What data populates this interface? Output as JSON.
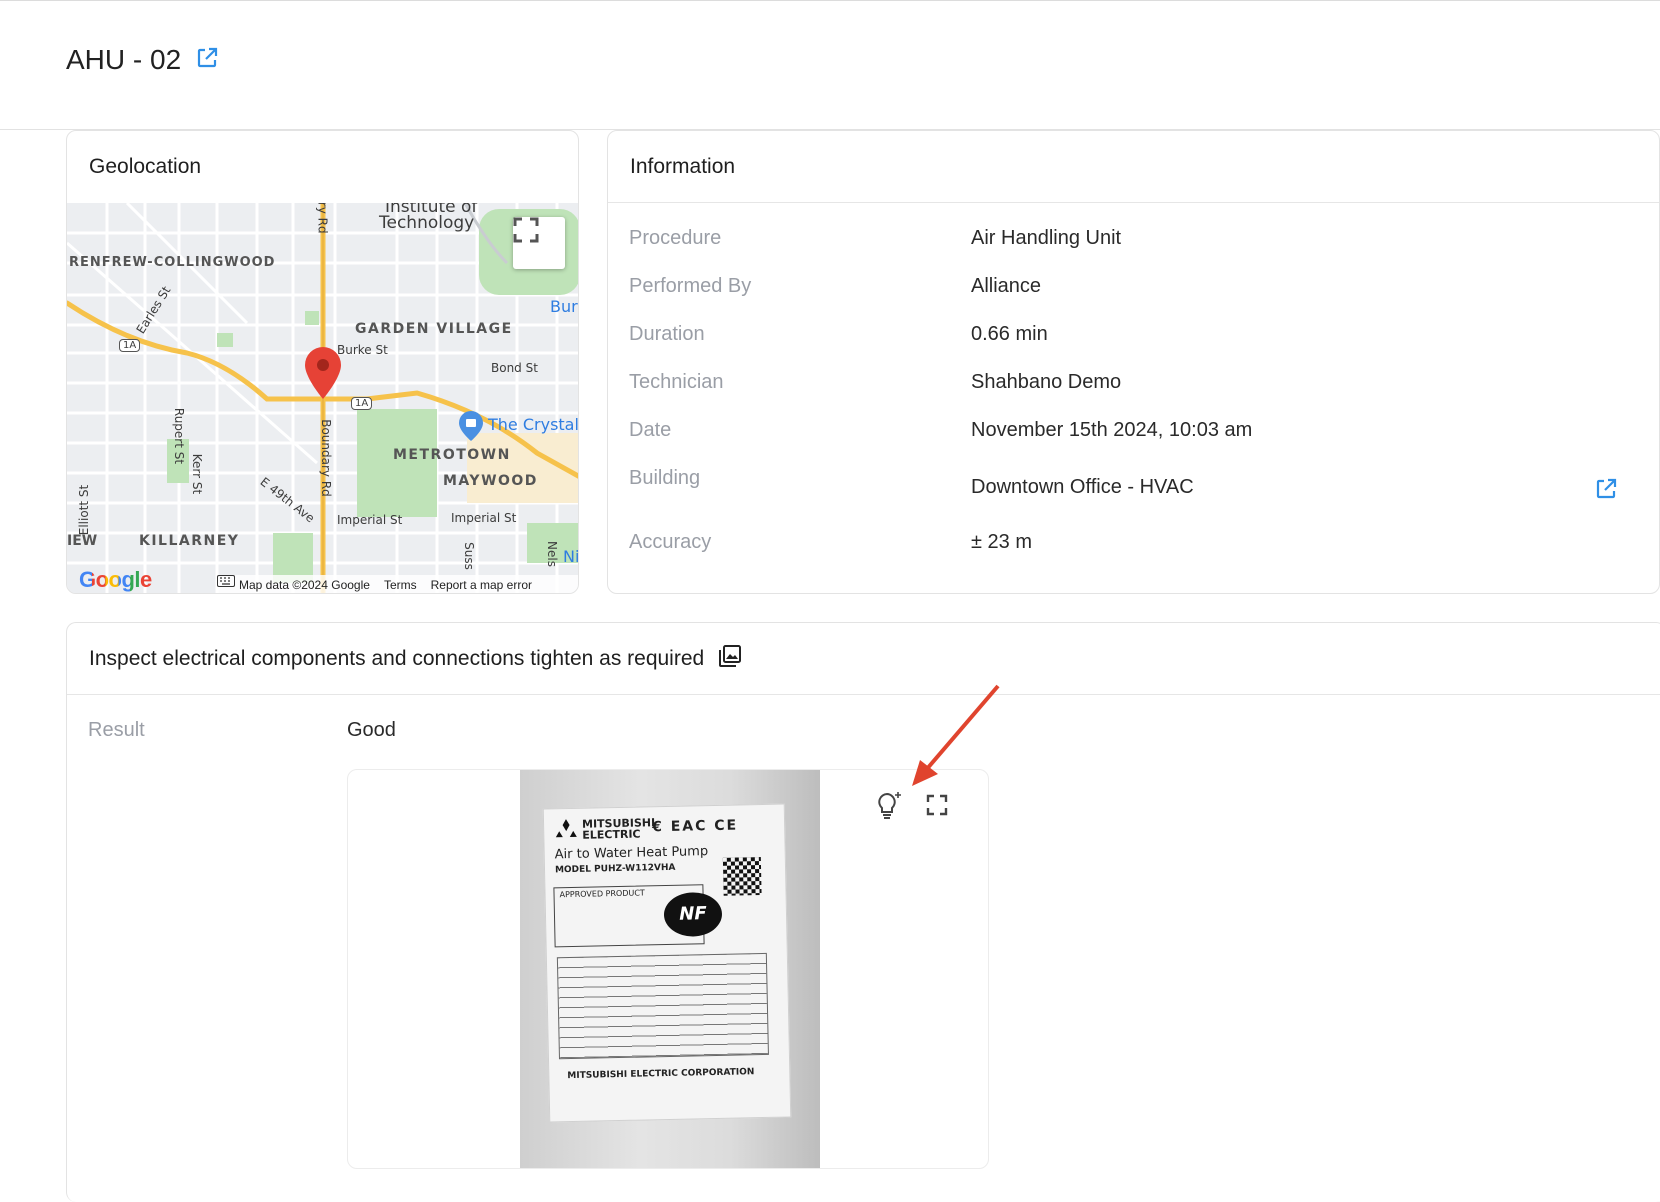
{
  "header": {
    "title": "AHU - 02",
    "open_icon": "external-link-icon"
  },
  "geolocation": {
    "title": "Geolocation",
    "map": {
      "places": {
        "institute": "Institute of",
        "technology": "Technology",
        "renfrew": "RENFREW-COLLINGWOOD",
        "garden_village": "GARDEN VILLAGE",
        "burke": "Burke St",
        "bond": "Bond St",
        "bur": "Bur",
        "crystal": "The Crystal",
        "metrotown": "METROTOWN",
        "maywood": "MAYWOOD",
        "imperial1": "Imperial St",
        "imperial2": "Imperial St",
        "e49": "E 49th Ave",
        "killarney": "KILLARNEY",
        "iew": "IEW",
        "earles": "Earles St",
        "rupert": "Rupert St",
        "kerr": "Kerr St",
        "boundary": "Boundary Rd",
        "ary": "ary Rd",
        "elliott": "Elliott St",
        "suss": "Suss",
        "nels": "Nels",
        "ni": "Ni",
        "hwy1": "1A",
        "hwy2": "1A"
      },
      "google": "Google",
      "attribution": "Map data ©2024 Google",
      "terms": "Terms",
      "report": "Report a map error"
    }
  },
  "information": {
    "title": "Information",
    "rows": [
      {
        "label": "Procedure",
        "value": "Air Handling Unit"
      },
      {
        "label": "Performed By",
        "value": "Alliance"
      },
      {
        "label": "Duration",
        "value": "0.66 min"
      },
      {
        "label": "Technician",
        "value": "Shahbano Demo"
      },
      {
        "label": "Date",
        "value": "November 15th 2024, 10:03 am"
      },
      {
        "label": "Building",
        "value": "Downtown Office - HVAC"
      },
      {
        "label": "Accuracy",
        "value": "± 23 m"
      }
    ]
  },
  "inspection": {
    "title": "Inspect electrical components and connections tighten as required",
    "gallery_icon": "gallery-icon",
    "result_label": "Result",
    "result_value": "Good",
    "photo": {
      "brand_line1": "MITSUBISHI",
      "brand_line2": "ELECTRIC",
      "marks": "€ EAC CE",
      "product": "Air to Water Heat Pump",
      "model": "MODEL PUHZ-W112VHA",
      "approved": "APPROVED PRODUCT",
      "nf": "NF",
      "corporation": "MITSUBISHI ELECTRIC CORPORATION"
    },
    "tools": {
      "ai": "lightbulb-sparkle-icon",
      "expand": "expand-icon"
    }
  },
  "colors": {
    "accent": "#2f8fe6",
    "annotation_arrow": "#e0442e",
    "map_road": "#f6c24b",
    "map_pin": "#e64236"
  }
}
